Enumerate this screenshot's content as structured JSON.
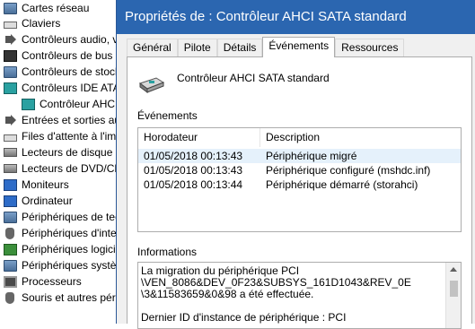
{
  "tree": {
    "items": [
      {
        "label": "Cartes réseau",
        "icon": "network-adapter-icon"
      },
      {
        "label": "Claviers",
        "icon": "keyboard-icon"
      },
      {
        "label": "Contrôleurs audio, v",
        "icon": "audio-icon"
      },
      {
        "label": "Contrôleurs de bus U",
        "icon": "usb-icon"
      },
      {
        "label": "Contrôleurs de stock",
        "icon": "storage-controller-icon"
      },
      {
        "label": "Contrôleurs IDE ATA",
        "icon": "ide-controller-icon"
      },
      {
        "label": "Contrôleur AHC",
        "icon": "ahci-controller-icon"
      },
      {
        "label": "Entrées et sorties au",
        "icon": "audio-io-icon"
      },
      {
        "label": "Files d'attente à l'im",
        "icon": "print-queue-icon"
      },
      {
        "label": "Lecteurs de disque",
        "icon": "disk-drive-icon"
      },
      {
        "label": "Lecteurs de DVD/CD",
        "icon": "dvd-drive-icon"
      },
      {
        "label": "Moniteurs",
        "icon": "monitor-icon"
      },
      {
        "label": "Ordinateur",
        "icon": "computer-icon"
      },
      {
        "label": "Périphériques de tec",
        "icon": "tech-device-icon"
      },
      {
        "label": "Périphériques d'inte",
        "icon": "hid-icon"
      },
      {
        "label": "Périphériques logici",
        "icon": "software-device-icon"
      },
      {
        "label": "Périphériques systèn",
        "icon": "system-device-icon"
      },
      {
        "label": "Processeurs",
        "icon": "processor-icon"
      },
      {
        "label": "Souris et autres périp",
        "icon": "mouse-icon"
      }
    ]
  },
  "dialog": {
    "title": "Propriétés de : Contrôleur AHCI SATA standard",
    "tabs": [
      "Général",
      "Pilote",
      "Détails",
      "Événements",
      "Ressources"
    ],
    "active_tab": "Événements",
    "device_name": "Contrôleur AHCI SATA standard",
    "events_label": "Événements",
    "columns": [
      "Horodateur",
      "Description"
    ],
    "events": [
      {
        "time": "01/05/2018 00:13:43",
        "description": "Périphérique migré"
      },
      {
        "time": "01/05/2018 00:13:43",
        "description": "Périphérique configuré (mshdc.inf)"
      },
      {
        "time": "01/05/2018 00:13:44",
        "description": "Périphérique démarré (storahci)"
      }
    ],
    "info_label": "Informations",
    "info_text": "La migration du périphérique PCI\n\\VEN_8086&DEV_0F23&SUBSYS_161D1043&REV_0E\n\\3&11583659&0&98 a été effectuée.\n\nDernier ID d'instance de périphérique : PCI"
  },
  "colors": {
    "titlebar": "#2b66b0",
    "selected_row": "#e5f1fb"
  }
}
